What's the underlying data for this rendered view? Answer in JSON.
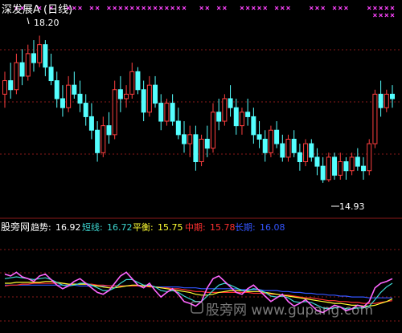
{
  "title": "深发展A (日线)",
  "indicator_label": "股旁网",
  "annotations": {
    "high_label": "18.20",
    "low_label": "14.93"
  },
  "legend": [
    {
      "label": "趋势:",
      "value": "16.92",
      "color": "#ffffff"
    },
    {
      "label": "短线:",
      "value": "16.72",
      "color": "#3dd6d0"
    },
    {
      "label": "平衡:",
      "value": "15.75",
      "color": "#ffff33"
    },
    {
      "label": "中期:",
      "value": "15.78",
      "color": "#ff3030"
    },
    {
      "label": "长期:",
      "value": "16.08",
      "color": "#3355ff"
    }
  ],
  "colors": {
    "up": "#ff3f3f",
    "down": "#54ffff",
    "marker": "#ff44ff",
    "grid": "#8a1a1a",
    "series_trend": "#ff66ff",
    "series_short": "#3dd6d0",
    "series_balance": "#ffff33",
    "series_mid": "#ff3030",
    "series_long": "#3355ff"
  },
  "watermark": "股旁网 www.gupang.com",
  "chart_data": [
    {
      "type": "candlestick",
      "title": "深发展A (日线)",
      "ylim": [
        14.5,
        18.6
      ],
      "grid": true,
      "candles": [
        [
          16.9,
          17.4,
          16.6,
          17.2
        ],
        [
          17.2,
          17.6,
          16.8,
          17.0
        ],
        [
          17.0,
          17.8,
          16.9,
          17.6
        ],
        [
          17.6,
          17.9,
          17.1,
          17.3
        ],
        [
          17.3,
          18.0,
          17.2,
          17.8
        ],
        [
          17.8,
          18.1,
          17.4,
          17.6
        ],
        [
          17.6,
          18.2,
          17.5,
          18.0
        ],
        [
          18.0,
          18.1,
          17.3,
          17.5
        ],
        [
          17.5,
          17.8,
          17.1,
          17.2
        ],
        [
          17.2,
          17.4,
          16.6,
          16.8
        ],
        [
          16.8,
          17.1,
          16.4,
          16.6
        ],
        [
          16.6,
          17.3,
          16.5,
          17.1
        ],
        [
          17.1,
          17.4,
          16.8,
          16.9
        ],
        [
          16.9,
          17.2,
          16.5,
          16.7
        ],
        [
          16.7,
          16.9,
          16.2,
          16.4
        ],
        [
          16.4,
          16.7,
          15.9,
          16.1
        ],
        [
          16.1,
          16.3,
          15.4,
          15.6
        ],
        [
          15.6,
          16.4,
          15.5,
          16.2
        ],
        [
          16.2,
          16.5,
          15.8,
          16.0
        ],
        [
          16.0,
          17.2,
          15.9,
          17.0
        ],
        [
          17.0,
          17.3,
          16.5,
          16.8
        ],
        [
          16.8,
          17.1,
          16.6,
          16.9
        ],
        [
          16.9,
          17.6,
          16.8,
          17.4
        ],
        [
          17.4,
          17.5,
          16.9,
          17.0
        ],
        [
          17.0,
          17.2,
          16.3,
          16.5
        ],
        [
          16.5,
          17.3,
          16.4,
          17.1
        ],
        [
          17.1,
          17.3,
          16.6,
          16.7
        ],
        [
          16.7,
          16.9,
          16.1,
          16.3
        ],
        [
          16.3,
          16.8,
          16.2,
          16.7
        ],
        [
          16.7,
          16.9,
          16.2,
          16.3
        ],
        [
          16.3,
          16.6,
          15.9,
          16.0
        ],
        [
          16.0,
          16.3,
          15.6,
          15.8
        ],
        [
          15.8,
          16.2,
          15.5,
          16.0
        ],
        [
          16.0,
          16.2,
          15.2,
          15.4
        ],
        [
          15.4,
          16.0,
          15.3,
          15.9
        ],
        [
          15.9,
          16.2,
          15.5,
          15.7
        ],
        [
          15.7,
          16.7,
          15.6,
          16.5
        ],
        [
          16.5,
          16.8,
          16.1,
          16.3
        ],
        [
          16.3,
          16.9,
          16.2,
          16.8
        ],
        [
          16.8,
          17.1,
          16.4,
          16.6
        ],
        [
          16.6,
          16.8,
          16.0,
          16.2
        ],
        [
          16.2,
          16.6,
          16.0,
          16.5
        ],
        [
          16.5,
          16.8,
          16.2,
          16.4
        ],
        [
          16.4,
          16.6,
          15.8,
          16.0
        ],
        [
          16.0,
          16.3,
          15.7,
          15.9
        ],
        [
          15.9,
          16.1,
          15.4,
          15.6
        ],
        [
          15.6,
          16.2,
          15.5,
          16.1
        ],
        [
          16.1,
          16.3,
          15.7,
          15.8
        ],
        [
          15.8,
          16.0,
          15.4,
          15.5
        ],
        [
          15.5,
          16.0,
          15.4,
          15.9
        ],
        [
          15.9,
          16.1,
          15.5,
          15.6
        ],
        [
          15.6,
          15.8,
          15.2,
          15.4
        ],
        [
          15.4,
          15.9,
          15.3,
          15.8
        ],
        [
          15.8,
          15.9,
          15.4,
          15.5
        ],
        [
          15.5,
          15.7,
          15.1,
          15.3
        ],
        [
          15.3,
          15.5,
          14.93,
          15.0
        ],
        [
          15.0,
          15.6,
          14.95,
          15.5
        ],
        [
          15.5,
          15.6,
          15.0,
          15.1
        ],
        [
          15.1,
          15.6,
          15.0,
          15.4
        ],
        [
          15.4,
          15.5,
          15.0,
          15.2
        ],
        [
          15.2,
          15.6,
          15.1,
          15.5
        ],
        [
          15.5,
          15.7,
          15.2,
          15.3
        ],
        [
          15.3,
          15.5,
          15.0,
          15.2
        ],
        [
          15.2,
          15.9,
          15.1,
          15.8
        ],
        [
          15.8,
          17.0,
          15.7,
          16.9
        ],
        [
          16.9,
          17.2,
          16.4,
          16.6
        ],
        [
          16.6,
          17.0,
          16.5,
          16.9
        ],
        [
          16.9,
          17.1,
          16.6,
          16.8
        ]
      ],
      "markers": [
        [
          2,
          3,
          6,
          8,
          11,
          12,
          13,
          15,
          16,
          18,
          19,
          20,
          21,
          22,
          23,
          24,
          25,
          26,
          27,
          28,
          29,
          30,
          31,
          34,
          35,
          37,
          38,
          41,
          42,
          43,
          44,
          45,
          47,
          48,
          49,
          53,
          54,
          55,
          57,
          58,
          59,
          63,
          64,
          65,
          66,
          67
        ],
        [
          64,
          65,
          66,
          67
        ]
      ]
    },
    {
      "type": "line",
      "title": "股旁网",
      "grid": true,
      "series": [
        {
          "name": "趋势",
          "values": [
            60,
            58,
            62,
            57,
            55,
            52,
            58,
            60,
            54,
            48,
            44,
            47,
            52,
            55,
            50,
            45,
            40,
            38,
            42,
            50,
            58,
            62,
            55,
            48,
            45,
            50,
            42,
            35,
            40,
            44,
            38,
            30,
            28,
            25,
            30,
            45,
            55,
            58,
            52,
            46,
            40,
            38,
            44,
            48,
            42,
            36,
            30,
            34,
            38,
            30,
            25,
            28,
            32,
            26,
            20,
            18,
            22,
            26,
            24,
            20,
            22,
            26,
            24,
            30,
            45,
            50,
            52,
            55
          ]
        },
        {
          "name": "短线",
          "values": [
            55,
            56,
            57,
            56,
            55,
            54,
            55,
            56,
            54,
            51,
            48,
            47,
            48,
            50,
            50,
            48,
            45,
            42,
            42,
            45,
            50,
            54,
            54,
            51,
            48,
            48,
            46,
            42,
            41,
            42,
            40,
            36,
            33,
            30,
            30,
            36,
            42,
            48,
            50,
            48,
            45,
            42,
            42,
            44,
            43,
            40,
            36,
            35,
            36,
            34,
            30,
            29,
            30,
            29,
            26,
            23,
            22,
            23,
            24,
            22,
            22,
            23,
            23,
            25,
            32,
            40,
            46,
            50
          ]
        },
        {
          "name": "平衡",
          "values": [
            50,
            50,
            51,
            51,
            51,
            51,
            51,
            52,
            52,
            51,
            50,
            49,
            49,
            49,
            49,
            48,
            47,
            46,
            45,
            45,
            46,
            47,
            48,
            48,
            47,
            47,
            46,
            45,
            44,
            43,
            42,
            41,
            40,
            38,
            37,
            37,
            38,
            40,
            41,
            42,
            42,
            42,
            41,
            41,
            41,
            40,
            39,
            38,
            37,
            36,
            35,
            34,
            33,
            32,
            31,
            30,
            29,
            28,
            28,
            27,
            26,
            26,
            25,
            25,
            26,
            28,
            30,
            33
          ]
        },
        {
          "name": "中期",
          "values": [
            47,
            48,
            48,
            49,
            49,
            50,
            50,
            50,
            50,
            50,
            50,
            49,
            49,
            49,
            49,
            49,
            48,
            48,
            47,
            47,
            47,
            47,
            47,
            47,
            47,
            46,
            46,
            45,
            45,
            44,
            44,
            43,
            42,
            41,
            41,
            40,
            40,
            40,
            40,
            40,
            40,
            40,
            40,
            39,
            39,
            39,
            38,
            38,
            37,
            37,
            36,
            35,
            34,
            34,
            33,
            32,
            31,
            31,
            30,
            30,
            29,
            29,
            28,
            28,
            28,
            29,
            30,
            31
          ]
        },
        {
          "name": "长期",
          "values": [
            48,
            48,
            48,
            48,
            48,
            48,
            48,
            48,
            48,
            48,
            48,
            48,
            48,
            47,
            47,
            47,
            47,
            47,
            47,
            47,
            47,
            47,
            47,
            47,
            47,
            47,
            46,
            46,
            46,
            46,
            46,
            45,
            45,
            45,
            44,
            44,
            44,
            44,
            44,
            44,
            44,
            43,
            43,
            43,
            43,
            42,
            42,
            42,
            41,
            41,
            40,
            40,
            39,
            39,
            38,
            38,
            37,
            37,
            36,
            36,
            35,
            35,
            35,
            34,
            34,
            34,
            34,
            34
          ]
        }
      ]
    }
  ]
}
